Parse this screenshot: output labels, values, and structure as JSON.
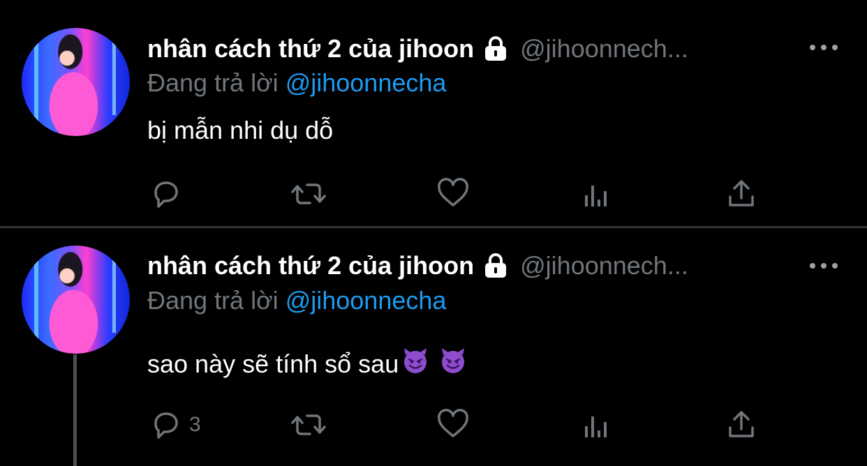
{
  "tweets": [
    {
      "display_name": "nhân cách thứ 2 của jihoon",
      "handle": "@jihoonnech...",
      "replying_prefix": "Đang trả lời",
      "replying_to": "@jihoonnecha",
      "text": "bị mẫn nhi dụ dỗ",
      "reply_count": ""
    },
    {
      "display_name": "nhân cách thứ 2 của jihoon",
      "handle": "@jihoonnech...",
      "replying_prefix": "Đang trả lời",
      "replying_to": "@jihoonnecha",
      "text": "sao này sẽ tính sổ sau",
      "reply_count": "3"
    }
  ],
  "icons": {
    "lock": "lock-icon",
    "more": "more-icon",
    "reply": "reply-icon",
    "retweet": "retweet-icon",
    "like": "like-icon",
    "views": "views-icon",
    "share": "share-icon",
    "emoji": "smiling-devil-emoji"
  },
  "colors": {
    "background": "#000000",
    "text": "#ffffff",
    "secondary": "#71767b",
    "link": "#1d9bf0",
    "divider": "#2f3336",
    "emoji": "#8e4ccf"
  }
}
